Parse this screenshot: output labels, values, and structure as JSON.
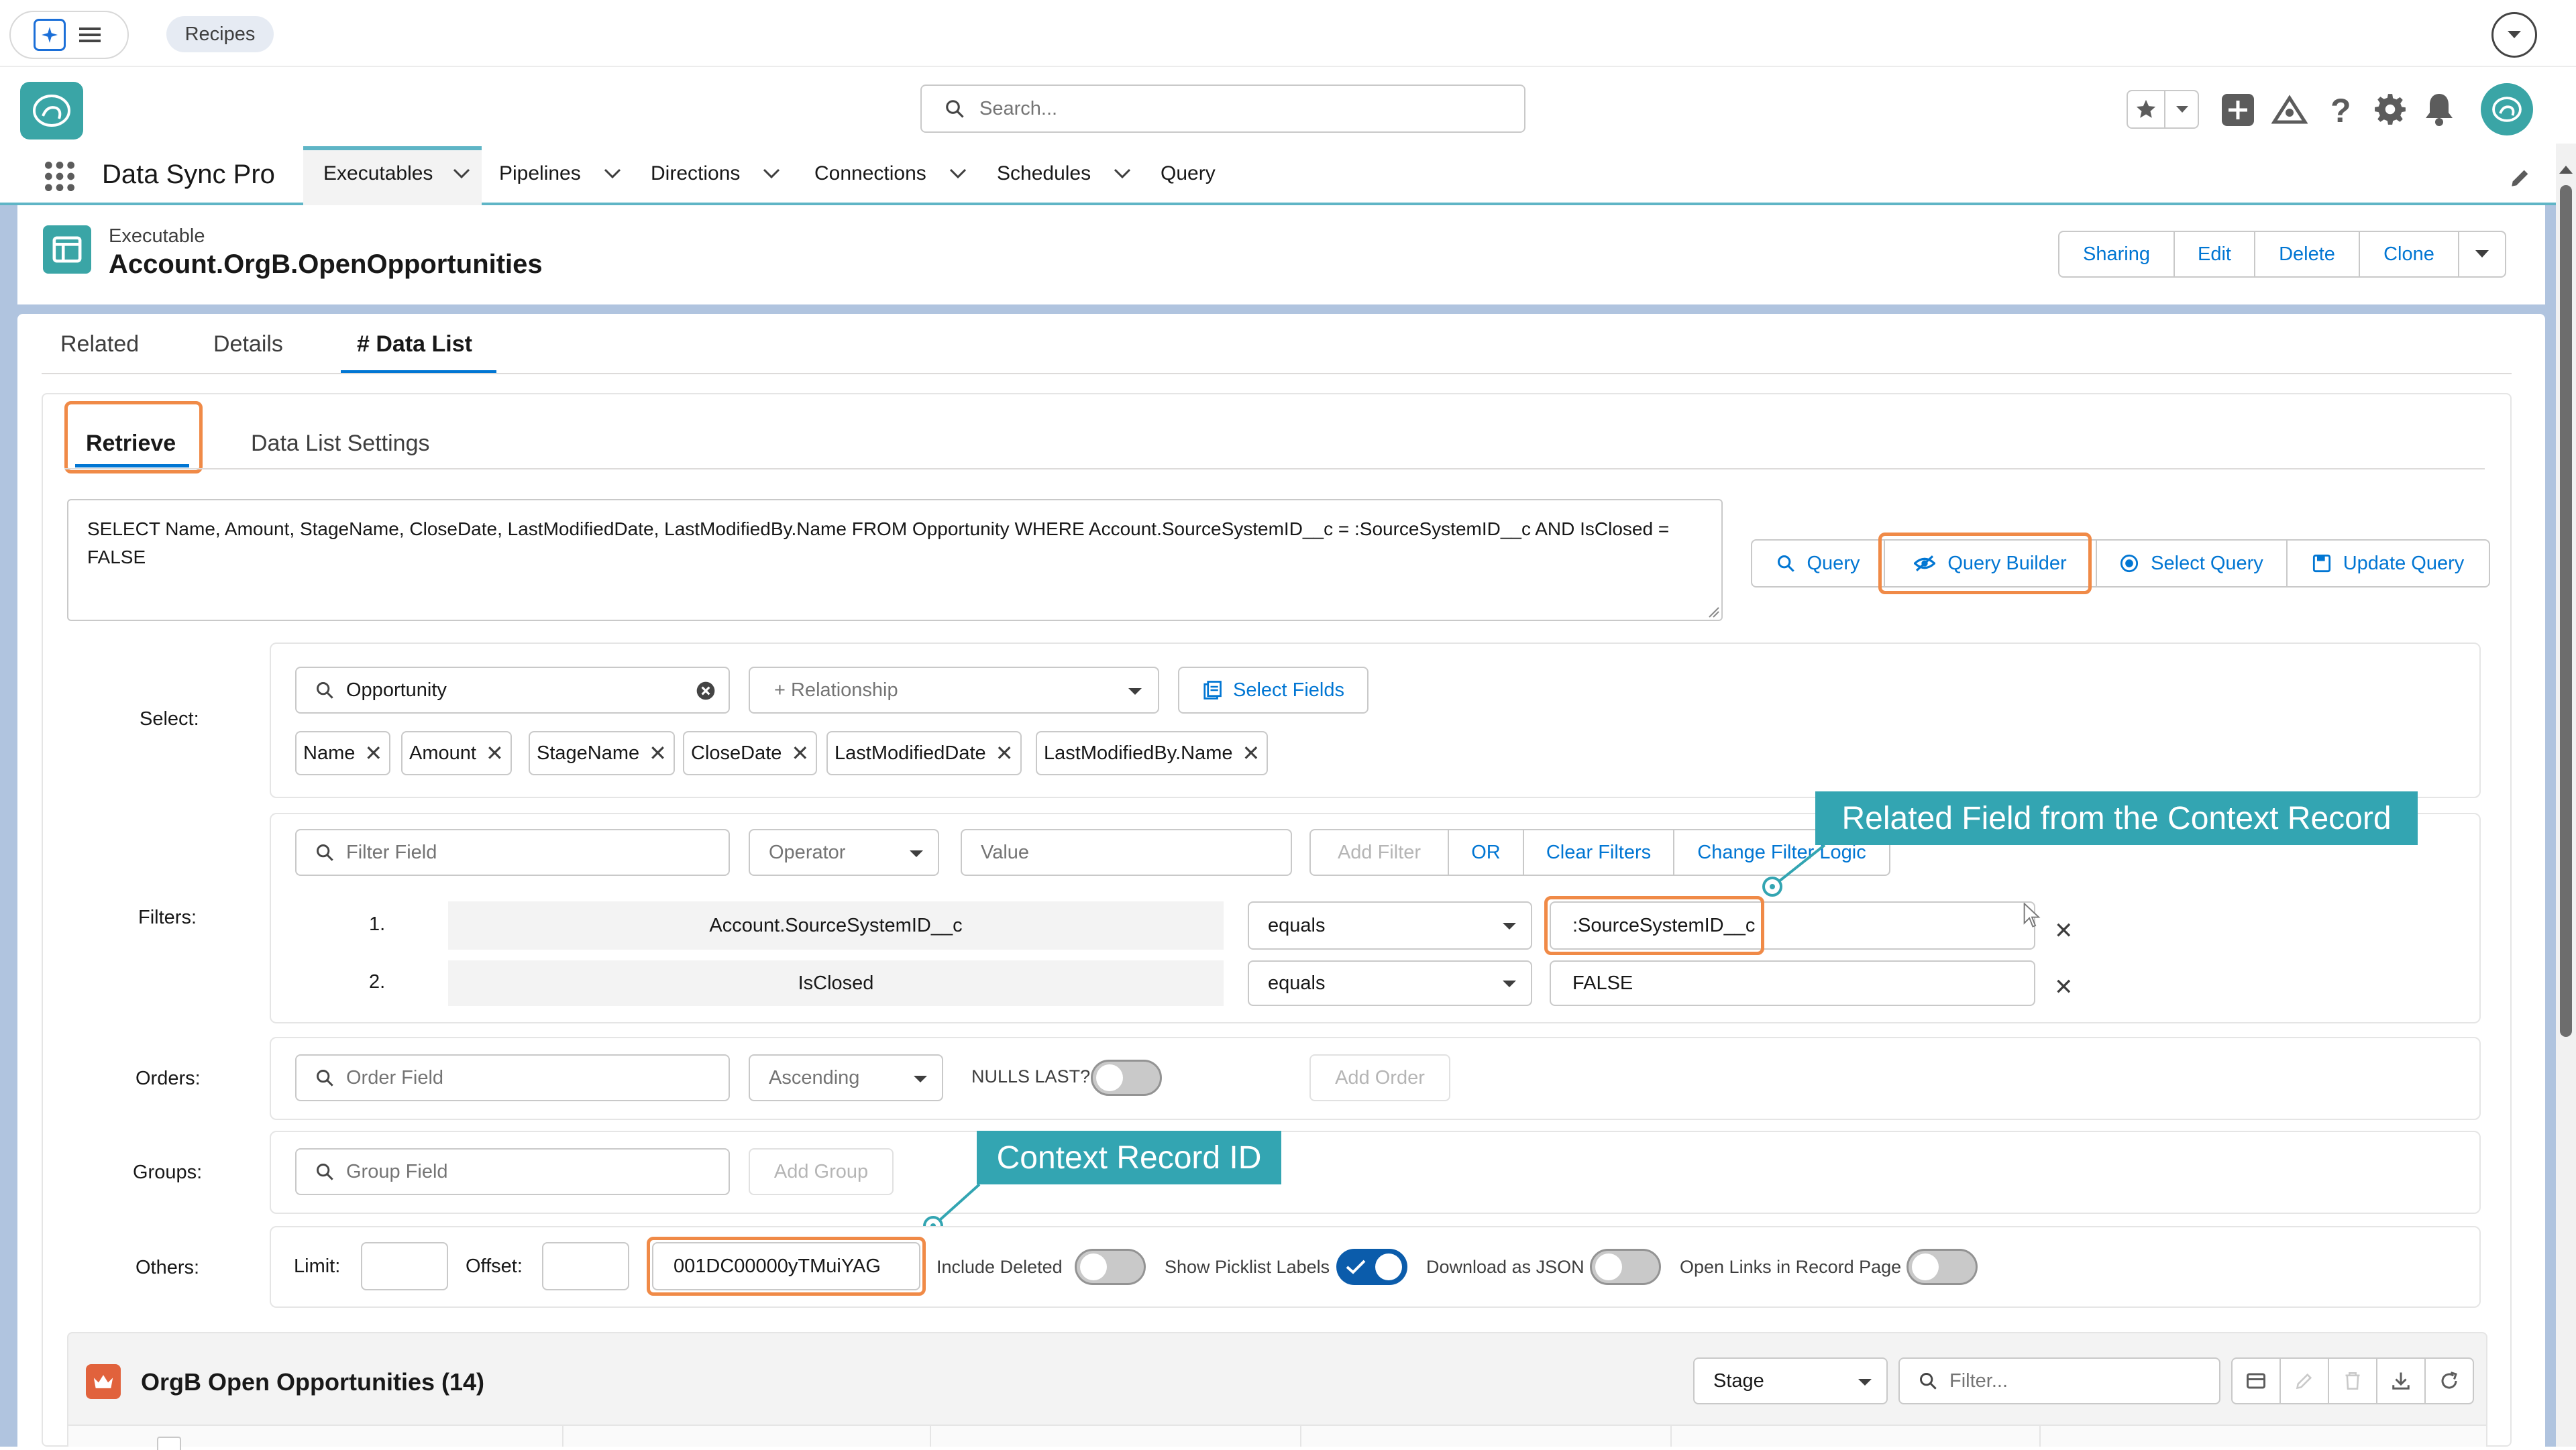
{
  "browser": {
    "tab_label": "Recipes"
  },
  "header": {
    "search_placeholder": "Search..."
  },
  "nav": {
    "app_name": "Data Sync Pro",
    "items": [
      {
        "label": "Executables"
      },
      {
        "label": "Pipelines"
      },
      {
        "label": "Directions"
      },
      {
        "label": "Connections"
      },
      {
        "label": "Schedules"
      },
      {
        "label": "Query"
      }
    ]
  },
  "record": {
    "type_label": "Executable",
    "title": "Account.OrgB.OpenOpportunities",
    "actions": [
      "Sharing",
      "Edit",
      "Delete",
      "Clone"
    ]
  },
  "tabs": [
    {
      "label": "Related"
    },
    {
      "label": "Details"
    },
    {
      "label": "# Data List"
    }
  ],
  "subtabs": [
    {
      "label": "Retrieve"
    },
    {
      "label": "Data List Settings"
    }
  ],
  "query_text": "SELECT Name, Amount, StageName, CloseDate, LastModifiedDate, LastModifiedBy.Name FROM Opportunity WHERE Account.SourceSystemID__c = :SourceSystemID__c AND IsClosed = FALSE",
  "query_buttons": [
    "Query",
    "Query Builder",
    "Select Query",
    "Update Query"
  ],
  "select": {
    "label": "Select:",
    "object": "Opportunity",
    "relationship_placeholder": "+ Relationship",
    "select_fields_label": "Select Fields",
    "fields": [
      "Name",
      "Amount",
      "StageName",
      "CloseDate",
      "LastModifiedDate",
      "LastModifiedBy.Name"
    ]
  },
  "filters": {
    "label": "Filters:",
    "field_placeholder": "Filter Field",
    "operator_placeholder": "Operator",
    "value_placeholder": "Value",
    "buttons": [
      "Add Filter",
      "OR",
      "Clear Filters",
      "Change Filter Logic"
    ],
    "rows": [
      {
        "num": "1.",
        "field": "Account.SourceSystemID__c",
        "operator": "equals",
        "value": ":SourceSystemID__c"
      },
      {
        "num": "2.",
        "field": "IsClosed",
        "operator": "equals",
        "value": "FALSE"
      }
    ]
  },
  "orders": {
    "label": "Orders:",
    "field_placeholder": "Order Field",
    "direction": "Ascending",
    "nulls_last_label": "NULLS LAST?",
    "add_label": "Add Order"
  },
  "groups": {
    "label": "Groups:",
    "field_placeholder": "Group Field",
    "add_label": "Add Group"
  },
  "others": {
    "label": "Others:",
    "limit_label": "Limit:",
    "offset_label": "Offset:",
    "context_id": "001DC00000yTMuiYAG",
    "toggles": [
      {
        "label": "Include Deleted",
        "on": false
      },
      {
        "label": "Show Picklist Labels",
        "on": true
      },
      {
        "label": "Download as JSON",
        "on": false
      },
      {
        "label": "Open Links in Record Page",
        "on": false
      }
    ]
  },
  "callouts": {
    "related_field": "Related Field from the Context Record",
    "context_id": "Context Record ID"
  },
  "list": {
    "title": "OrgB Open Opportunities (14)",
    "group_by": "Stage",
    "filter_placeholder": "Filter..."
  },
  "colors": {
    "brand_blue": "#0176d3",
    "callout_teal": "#33a5b2",
    "highlight_orange": "#f08a47"
  }
}
